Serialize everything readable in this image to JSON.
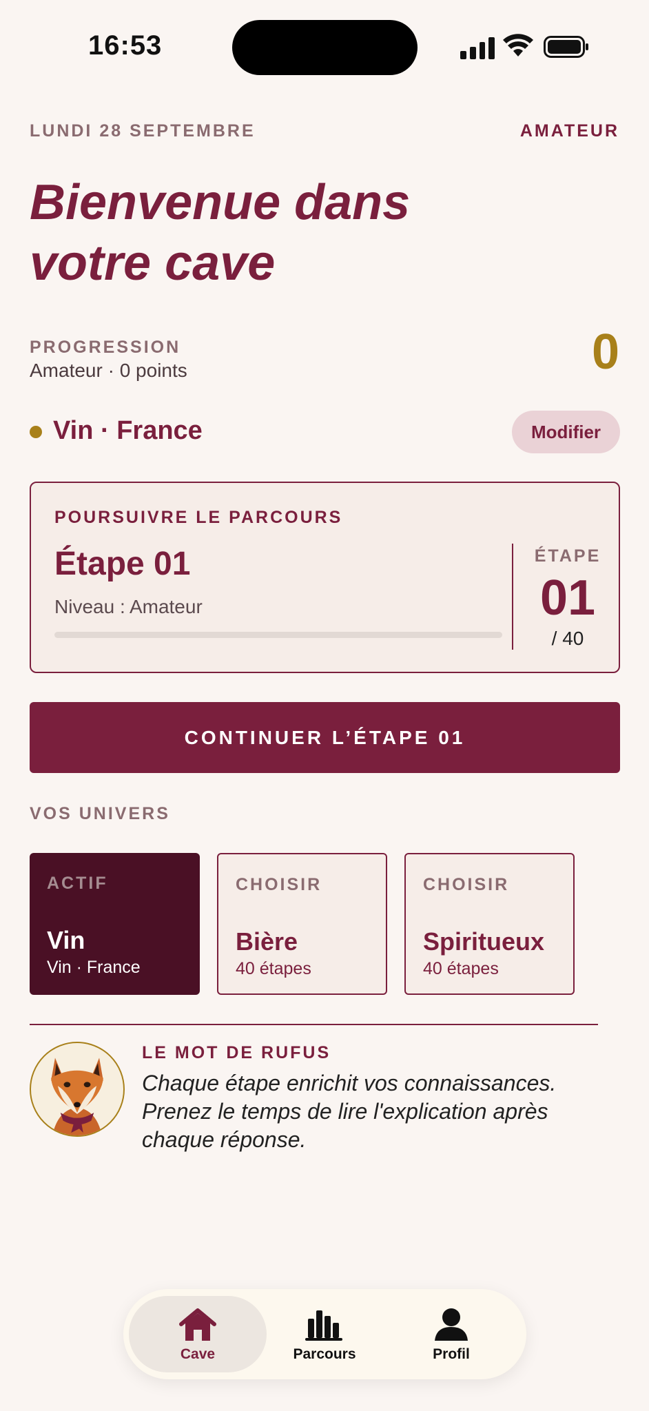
{
  "status_bar": {
    "time": "16:53"
  },
  "header": {
    "date": "LUNDI 28 SEPTEMBRE",
    "level": "AMATEUR",
    "title": "Bienvenue dans votre cave"
  },
  "progression": {
    "label": "PROGRESSION",
    "subtitle": "Amateur · 0 points",
    "points": "0"
  },
  "universe": {
    "current": "Vin · France",
    "modify_label": "Modifier"
  },
  "course_card": {
    "kicker": "POURSUIVRE LE PARCOURS",
    "title": "Étape 01",
    "level": "Niveau : Amateur",
    "progress": 0,
    "step_label": "ÉTAPE",
    "step_number": "01",
    "step_total": "/ 40"
  },
  "continue_button": {
    "label": "CONTINUER L’ÉTAPE 01"
  },
  "universes": {
    "label": "VOS UNIVERS",
    "items": [
      {
        "kicker": "ACTIF",
        "name": "Vin",
        "sub": "Vin · France"
      },
      {
        "kicker": "CHOISIR",
        "name": "Bière",
        "sub": "40 étapes"
      },
      {
        "kicker": "CHOISIR",
        "name": "Spiritueux",
        "sub": "40 étapes"
      }
    ]
  },
  "rufus": {
    "label": "LE MOT DE RUFUS",
    "quote": "Chaque étape enrichit vos connaissances. Prenez le temps de lire l'explication après chaque réponse."
  },
  "tabbar": {
    "items": [
      {
        "label": "Cave",
        "icon": "house-icon"
      },
      {
        "label": "Parcours",
        "icon": "bar-chart-icon"
      },
      {
        "label": "Profil",
        "icon": "user-icon"
      }
    ]
  },
  "colors": {
    "accent": "#7a1f3d",
    "gold": "#a8801a",
    "background": "#faf5f2",
    "active_card": "#4a1025"
  }
}
